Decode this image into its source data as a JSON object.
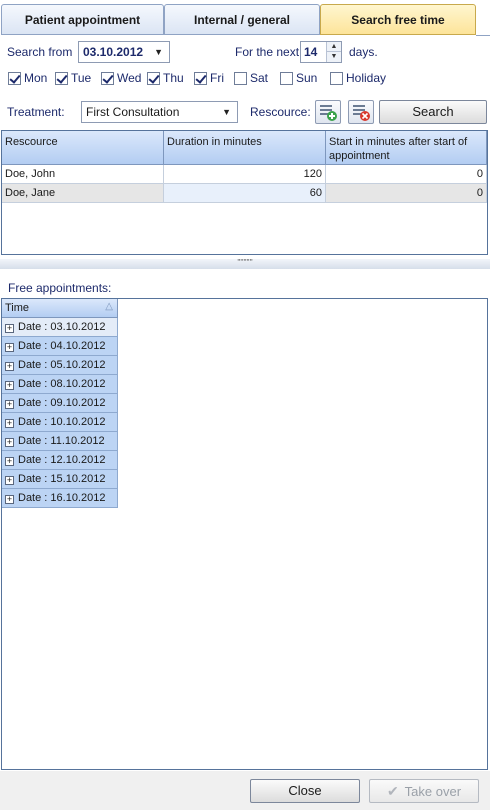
{
  "tabs": [
    {
      "label": "Patient appointment",
      "active": false
    },
    {
      "label": "Internal / general",
      "active": false
    },
    {
      "label": "Search free time",
      "active": true
    }
  ],
  "search": {
    "from_label": "Search from",
    "from_value": "03.10.2012",
    "next_label": "For the next",
    "next_value": "14",
    "days_label": "days."
  },
  "weekdays": [
    {
      "label": "Mon",
      "checked": true
    },
    {
      "label": "Tue",
      "checked": true
    },
    {
      "label": "Wed",
      "checked": true
    },
    {
      "label": "Thu",
      "checked": true
    },
    {
      "label": "Fri",
      "checked": true
    },
    {
      "label": "Sat",
      "checked": false
    },
    {
      "label": "Sun",
      "checked": false
    },
    {
      "label": "Holiday",
      "checked": false
    }
  ],
  "treatment": {
    "label": "Treatment:",
    "value": "First Consultation",
    "resource_label": "Rescource:",
    "search_button": "Search"
  },
  "resource_grid": {
    "columns": [
      "Rescource",
      "Duration in minutes",
      "Start in minutes after start of appointment"
    ],
    "rows": [
      [
        "Doe, John",
        "120",
        "0"
      ],
      [
        "Doe, Jane",
        "60",
        "0"
      ]
    ]
  },
  "splitter_glyph": "''''''''''",
  "free": {
    "title": "Free appointments:",
    "column": "Time",
    "rows": [
      "Date  : 03.10.2012",
      "Date  : 04.10.2012",
      "Date  : 05.10.2012",
      "Date  : 08.10.2012",
      "Date  : 09.10.2012",
      "Date  : 10.10.2012",
      "Date  : 11.10.2012",
      "Date  : 12.10.2012",
      "Date  : 15.10.2012",
      "Date  : 16.10.2012"
    ]
  },
  "footer": {
    "close": "Close",
    "take_over": "Take over"
  },
  "colors": {
    "active_tab": "#fde49a",
    "header_blue": "#b3cdf2",
    "row_blue": "#bcd4f4"
  }
}
